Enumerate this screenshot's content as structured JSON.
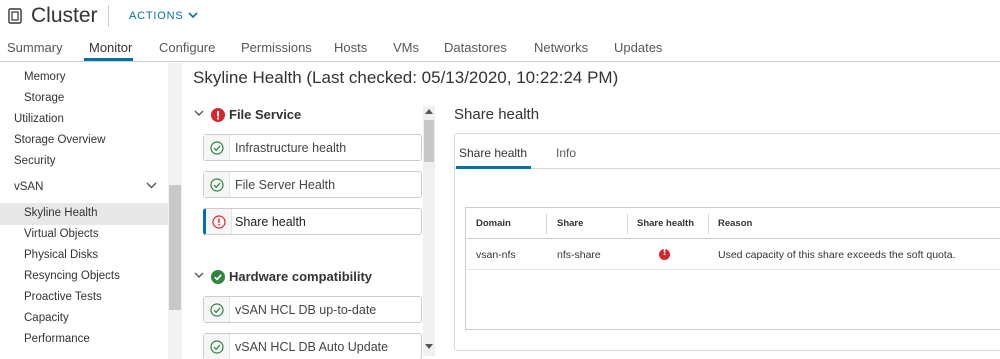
{
  "header": {
    "title": "Cluster",
    "actions_label": "ACTIONS"
  },
  "tabs": [
    {
      "label": "Summary",
      "active": false
    },
    {
      "label": "Monitor",
      "active": true
    },
    {
      "label": "Configure",
      "active": false
    },
    {
      "label": "Permissions",
      "active": false
    },
    {
      "label": "Hosts",
      "active": false
    },
    {
      "label": "VMs",
      "active": false
    },
    {
      "label": "Datastores",
      "active": false
    },
    {
      "label": "Networks",
      "active": false
    },
    {
      "label": "Updates",
      "active": false
    }
  ],
  "leftnav": {
    "items": [
      {
        "label": "Memory"
      },
      {
        "label": "Storage"
      },
      {
        "label": "Utilization"
      },
      {
        "label": "Storage Overview"
      },
      {
        "label": "Security"
      },
      {
        "label": "vSAN"
      },
      {
        "label": "Skyline Health",
        "selected": true
      },
      {
        "label": "Virtual Objects"
      },
      {
        "label": "Physical Disks"
      },
      {
        "label": "Resyncing Objects"
      },
      {
        "label": "Proactive Tests"
      },
      {
        "label": "Capacity"
      },
      {
        "label": "Performance"
      }
    ]
  },
  "main": {
    "title": "Skyline Health (Last checked: 05/13/2020, 10:22:24 PM)"
  },
  "health": {
    "groups": [
      {
        "label": "File Service",
        "status": "error",
        "items": [
          {
            "label": "Infrastructure health",
            "status": "ok"
          },
          {
            "label": "File Server Health",
            "status": "ok"
          },
          {
            "label": "Share health",
            "status": "error",
            "selected": true
          }
        ]
      },
      {
        "label": "Hardware compatibility",
        "status": "ok",
        "items": [
          {
            "label": "vSAN HCL DB up-to-date",
            "status": "ok"
          },
          {
            "label": "vSAN HCL DB Auto Update",
            "status": "ok"
          }
        ]
      }
    ]
  },
  "detail": {
    "title": "Share health",
    "tabs": [
      {
        "label": "Share health",
        "active": true
      },
      {
        "label": "Info",
        "active": false
      }
    ],
    "table": {
      "columns": [
        "Domain",
        "Share",
        "Share health",
        "Reason"
      ],
      "rows": [
        {
          "domain": "vsan-nfs",
          "share": "nfs-share",
          "health": "error",
          "reason": "Used capacity of this share exceeds the soft quota."
        }
      ]
    }
  },
  "colors": {
    "accent": "#0072a3",
    "error": "#d8262e",
    "ok": "#2e8540"
  }
}
